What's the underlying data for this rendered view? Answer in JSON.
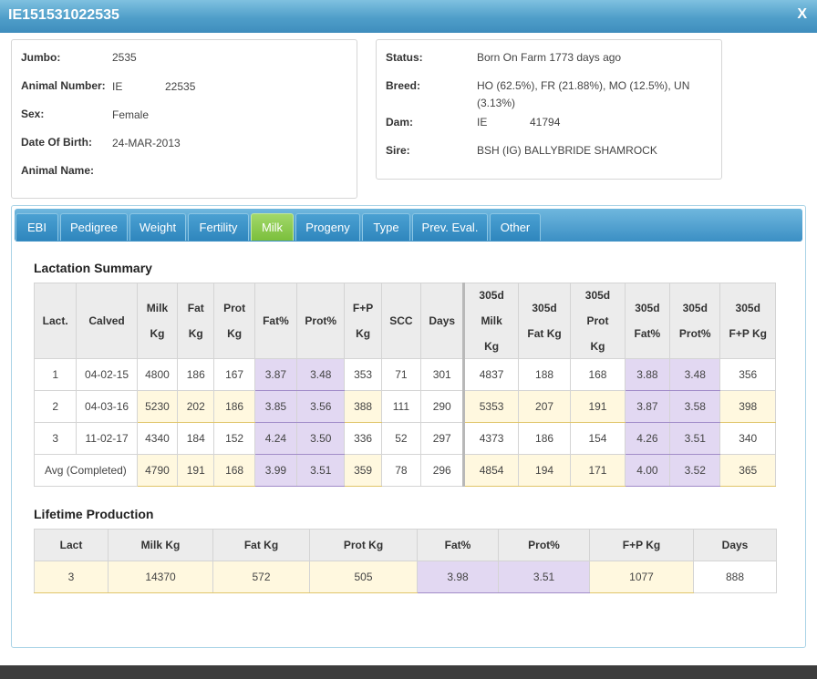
{
  "window": {
    "title": "IE151531022535",
    "close_label": "X"
  },
  "animal": {
    "jumbo_label": "Jumbo:",
    "jumbo": "2535",
    "number_label": "Animal Number:",
    "number_prefix": "IE",
    "number": "22535",
    "sex_label": "Sex:",
    "sex": "Female",
    "dob_label": "Date Of Birth:",
    "dob": "24-MAR-2013",
    "name_label": "Animal Name:",
    "name": ""
  },
  "pedigree": {
    "status_label": "Status:",
    "status": "Born On Farm 1773 days ago",
    "breed_label": "Breed:",
    "breed_line1": "HO (62.5%), FR (21.88%), MO (12.5%), UN",
    "breed_line2": "(3.13%)",
    "dam_label": "Dam:",
    "dam_prefix": "IE",
    "dam": "41794",
    "sire_label": "Sire:",
    "sire": "BSH (IG) BALLYBRIDE SHAMROCK"
  },
  "tabs": [
    {
      "label": "EBI"
    },
    {
      "label": "Pedigree"
    },
    {
      "label": "Weight"
    },
    {
      "label": "Fertility"
    },
    {
      "label": "Milk"
    },
    {
      "label": "Progeny"
    },
    {
      "label": "Type"
    },
    {
      "label": "Prev. Eval."
    },
    {
      "label": "Other"
    }
  ],
  "active_tab": "Milk",
  "lactation": {
    "title": "Lactation Summary",
    "headers": {
      "lact": "Lact.",
      "calved": "Calved",
      "milk1": "Milk",
      "milk2": "Kg",
      "fat1": "Fat",
      "fat2": "Kg",
      "prot1": "Prot",
      "prot2": "Kg",
      "fatpct": "Fat%",
      "protpct": "Prot%",
      "fp1": "F+P",
      "fp2": "Kg",
      "scc": "SCC",
      "days": "Days",
      "m305a": "305d",
      "m305b": "Milk",
      "m305c": "Kg",
      "f305a": "305d",
      "f305b": "Fat Kg",
      "p305a": "305d",
      "p305b": "Prot",
      "p305c": "Kg",
      "fpct305a": "305d",
      "fpct305b": "Fat%",
      "ppct305a": "305d",
      "ppct305b": "Prot%",
      "fp305a": "305d",
      "fp305b": "F+P Kg"
    },
    "rows": [
      [
        "1",
        "04-02-15",
        "4800",
        "186",
        "167",
        "3.87",
        "3.48",
        "353",
        "71",
        "301",
        "4837",
        "188",
        "168",
        "3.88",
        "3.48",
        "356"
      ],
      [
        "2",
        "04-03-16",
        "5230",
        "202",
        "186",
        "3.85",
        "3.56",
        "388",
        "111",
        "290",
        "5353",
        "207",
        "191",
        "3.87",
        "3.58",
        "398"
      ],
      [
        "3",
        "11-02-17",
        "4340",
        "184",
        "152",
        "4.24",
        "3.50",
        "336",
        "52",
        "297",
        "4373",
        "186",
        "154",
        "4.26",
        "3.51",
        "340"
      ]
    ],
    "avg": {
      "label": "Avg (Completed)",
      "values": [
        "4790",
        "191",
        "168",
        "3.99",
        "3.51",
        "359",
        "78",
        "296",
        "4854",
        "194",
        "171",
        "4.00",
        "3.52",
        "365"
      ]
    }
  },
  "lifetime": {
    "title": "Lifetime Production",
    "headers": [
      "Lact",
      "Milk Kg",
      "Fat Kg",
      "Prot Kg",
      "Fat%",
      "Prot%",
      "F+P Kg",
      "Days"
    ],
    "values": [
      "3",
      "14370",
      "572",
      "505",
      "3.98",
      "3.51",
      "1077",
      "888"
    ]
  },
  "colors": {
    "title_bar": "#4f9ec9",
    "active_tab": "#7bbf3c",
    "yellow_cell": "#fff8df",
    "purple_cell": "#e2d8f2"
  }
}
